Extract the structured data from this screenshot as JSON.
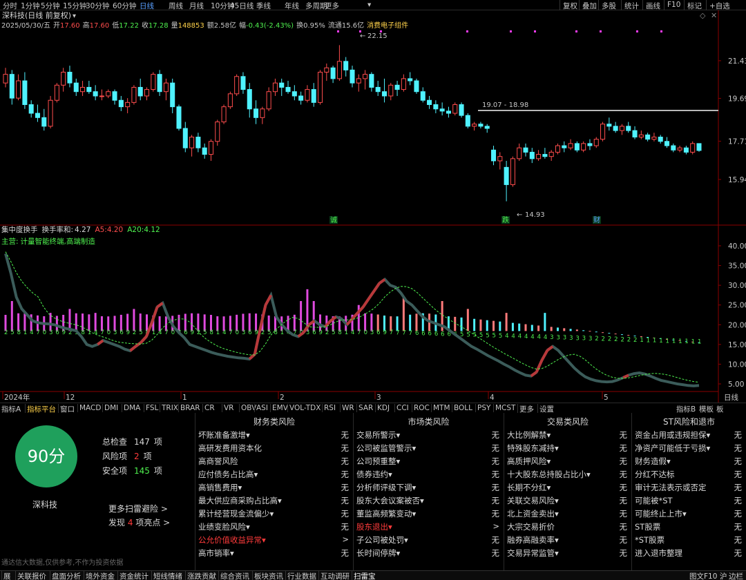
{
  "topbar": {
    "periods": [
      "分时",
      "1分钟",
      "5分钟",
      "15分钟",
      "30分钟",
      "60分钟",
      "日线",
      "周线",
      "月线",
      "10分钟",
      "45日线",
      "季线",
      "年线",
      "多周期",
      "更多"
    ],
    "active": "日线",
    "right": [
      "复权",
      "叠加",
      "多股",
      "统计",
      "画线",
      "F10",
      "标记",
      "+自选"
    ]
  },
  "header": {
    "title": "深科技(日线 前复权)",
    "date": "2025/05/30/五",
    "open_label": "开",
    "open": "17.60",
    "high_label": "高",
    "high": "17.60",
    "low_label": "低",
    "low": "17.22",
    "close_label": "收",
    "close": "17.28",
    "vol_label": "量",
    "vol": "148853",
    "amt_label": "额",
    "amt": "2.58亿",
    "chg_label": "幅",
    "chg": "-0.43(-2.43%)",
    "turn_label": "换",
    "turn": "0.95%",
    "float_label": "流通",
    "float": "15.6亿",
    "sector": "消费电子组件"
  },
  "colors": {
    "up": "#ff4d4d",
    "down": "#4ff2ff",
    "magenta": "#ff3cff",
    "line": "#2f5353",
    "accent": "#ffd24a"
  },
  "price_axis": [
    "21.43",
    "19.69",
    "17.71",
    "15.94"
  ],
  "annotations": {
    "high": "22.15",
    "low": "14.93",
    "range": "19.07 - 18.98",
    "marks": [
      "诚",
      "跌",
      "财"
    ]
  },
  "indicator": {
    "name": "集中度换手",
    "sum_label": "换手率和:",
    "sum": "4.27",
    "a5_label": "A5:",
    "a5": "4.20",
    "a20_label": "A20:",
    "a20": "4.12",
    "main_label": "主营:",
    "main": "计量智能终端,高端制造",
    "axis": [
      "40.00",
      "35.00",
      "30.00",
      "25.00",
      "20.00",
      "15.00",
      "10.00",
      "5.00"
    ]
  },
  "time_axis": [
    "2024年",
    "12",
    "1",
    "2",
    "3",
    "4",
    "5"
  ],
  "time_axis_right": "日线",
  "bottombar": {
    "tabs": [
      "指标A",
      "指标平台",
      "窗口",
      "MACD",
      "DMI",
      "DMA",
      "FSL",
      "TRIX",
      "BRAR",
      "CR",
      "VR",
      "OBV",
      "ASI",
      "EMV",
      "VOL-TDX",
      "RSI",
      "WR",
      "SAR",
      "KDJ",
      "CCI",
      "ROC",
      "MTM",
      "BOLL",
      "PSY",
      "MCST",
      "更多",
      "设置"
    ],
    "right": [
      "指标B",
      "模板",
      "板"
    ]
  },
  "chart_data": {
    "type": "candlestick",
    "ylim": [
      14.5,
      22.8
    ],
    "candles": [
      [
        20.4,
        21.1,
        20.2,
        20.8
      ],
      [
        20.8,
        21.0,
        19.4,
        19.7
      ],
      [
        19.7,
        20.8,
        19.6,
        20.5
      ],
      [
        20.5,
        20.9,
        19.2,
        19.4
      ],
      [
        19.4,
        19.6,
        18.8,
        19.0
      ],
      [
        19.0,
        19.4,
        18.6,
        18.8
      ],
      [
        18.8,
        19.2,
        18.2,
        18.4
      ],
      [
        18.4,
        19.8,
        18.3,
        19.6
      ],
      [
        19.6,
        20.4,
        19.5,
        20.3
      ],
      [
        20.3,
        21.1,
        20.0,
        20.9
      ],
      [
        20.9,
        21.2,
        20.2,
        20.4
      ],
      [
        20.4,
        20.6,
        19.8,
        20.0
      ],
      [
        20.0,
        20.5,
        19.8,
        20.2
      ],
      [
        20.2,
        20.5,
        19.9,
        20.0
      ],
      [
        20.0,
        20.3,
        19.6,
        19.8
      ],
      [
        19.8,
        20.1,
        19.6,
        19.8
      ],
      [
        19.8,
        20.1,
        19.7,
        20.0
      ],
      [
        20.0,
        20.1,
        19.4,
        19.6
      ],
      [
        19.6,
        19.8,
        19.1,
        19.3
      ],
      [
        19.3,
        19.7,
        19.0,
        19.5
      ],
      [
        19.5,
        20.3,
        19.4,
        20.2
      ],
      [
        20.2,
        20.6,
        19.6,
        19.8
      ],
      [
        19.8,
        20.2,
        19.6,
        20.1
      ],
      [
        20.1,
        20.9,
        20.0,
        20.8
      ],
      [
        20.8,
        21.0,
        19.8,
        20.0
      ],
      [
        20.0,
        20.6,
        19.6,
        20.4
      ],
      [
        20.4,
        20.6,
        19.0,
        19.3
      ],
      [
        19.3,
        19.4,
        18.2,
        18.3
      ],
      [
        18.3,
        18.6,
        17.2,
        17.4
      ],
      [
        17.4,
        18.0,
        17.0,
        17.9
      ],
      [
        17.9,
        18.1,
        17.2,
        17.4
      ],
      [
        17.4,
        17.6,
        16.9,
        17.1
      ],
      [
        17.1,
        17.8,
        16.8,
        17.7
      ],
      [
        17.7,
        18.7,
        17.5,
        18.6
      ],
      [
        18.6,
        19.4,
        18.5,
        19.3
      ],
      [
        19.3,
        20.0,
        19.2,
        19.9
      ],
      [
        19.9,
        20.8,
        19.8,
        20.7
      ],
      [
        20.7,
        20.9,
        19.9,
        20.1
      ],
      [
        20.1,
        20.4,
        18.8,
        19.2
      ],
      [
        19.2,
        19.6,
        18.5,
        18.8
      ],
      [
        18.8,
        19.3,
        18.5,
        19.2
      ],
      [
        19.2,
        20.2,
        19.1,
        20.0
      ],
      [
        20.0,
        20.6,
        19.8,
        20.4
      ],
      [
        20.4,
        20.6,
        19.8,
        20.2
      ],
      [
        20.2,
        20.5,
        19.9,
        20.0
      ],
      [
        20.0,
        20.3,
        19.6,
        19.8
      ],
      [
        19.8,
        20.0,
        19.4,
        19.6
      ],
      [
        19.6,
        20.3,
        19.5,
        20.1
      ],
      [
        20.1,
        20.4,
        19.3,
        19.5
      ],
      [
        19.5,
        21.0,
        19.4,
        20.9
      ],
      [
        20.9,
        21.3,
        20.5,
        21.1
      ],
      [
        21.1,
        21.2,
        20.4,
        20.6
      ],
      [
        20.6,
        22.15,
        20.5,
        21.4
      ],
      [
        21.4,
        21.6,
        20.7,
        21.0
      ],
      [
        21.0,
        21.2,
        20.2,
        20.4
      ],
      [
        20.4,
        20.8,
        20.0,
        20.6
      ],
      [
        20.6,
        21.0,
        20.1,
        20.8
      ],
      [
        20.8,
        20.9,
        20.0,
        20.2
      ],
      [
        20.2,
        20.5,
        19.8,
        20.0
      ],
      [
        20.0,
        20.6,
        19.5,
        19.8
      ],
      [
        19.8,
        20.4,
        19.6,
        20.3
      ],
      [
        20.3,
        20.5,
        19.8,
        20.1
      ],
      [
        20.1,
        20.8,
        20.0,
        20.6
      ],
      [
        20.6,
        20.9,
        20.3,
        20.5
      ],
      [
        20.5,
        20.6,
        19.9,
        20.0
      ],
      [
        20.0,
        20.2,
        19.5,
        19.6
      ],
      [
        19.6,
        19.8,
        19.2,
        19.4
      ],
      [
        19.4,
        19.6,
        19.0,
        19.2
      ],
      [
        19.2,
        19.5,
        18.9,
        19.1
      ],
      [
        19.1,
        19.3,
        18.8,
        19.0
      ],
      [
        19.0,
        19.5,
        18.9,
        19.4
      ],
      [
        19.4,
        19.5,
        18.8,
        18.9
      ],
      [
        18.9,
        19.0,
        18.3,
        18.4
      ],
      [
        18.4,
        18.6,
        18.2,
        18.5
      ],
      [
        18.5,
        18.6,
        18.3,
        18.4
      ],
      [
        18.4,
        18.5,
        18.1,
        18.3
      ],
      [
        17.3,
        17.5,
        16.6,
        16.8
      ],
      [
        16.8,
        17.2,
        16.4,
        17.0
      ],
      [
        16.5,
        16.8,
        14.93,
        15.7
      ],
      [
        15.7,
        17.0,
        15.6,
        16.9
      ],
      [
        16.9,
        17.6,
        16.8,
        17.4
      ],
      [
        17.4,
        17.6,
        17.0,
        17.2
      ],
      [
        17.2,
        17.4,
        16.7,
        16.9
      ],
      [
        16.9,
        17.3,
        16.8,
        17.1
      ],
      [
        17.1,
        17.4,
        16.9,
        17.0
      ],
      [
        17.0,
        17.3,
        16.8,
        17.2
      ],
      [
        17.2,
        17.6,
        17.1,
        17.5
      ],
      [
        17.5,
        17.7,
        17.2,
        17.4
      ],
      [
        17.4,
        17.8,
        17.3,
        17.6
      ],
      [
        17.6,
        17.7,
        17.2,
        17.3
      ],
      [
        17.3,
        17.7,
        17.2,
        17.6
      ],
      [
        17.6,
        17.8,
        17.3,
        17.5
      ],
      [
        17.5,
        17.9,
        17.4,
        17.8
      ],
      [
        17.8,
        18.6,
        17.7,
        18.5
      ],
      [
        18.5,
        18.8,
        18.2,
        18.4
      ],
      [
        18.4,
        18.6,
        18.1,
        18.2
      ],
      [
        18.2,
        18.5,
        18.0,
        18.4
      ],
      [
        18.4,
        18.6,
        18.1,
        18.2
      ],
      [
        18.2,
        18.4,
        17.8,
        17.9
      ],
      [
        17.9,
        18.2,
        17.8,
        18.0
      ],
      [
        18.0,
        18.1,
        17.7,
        17.8
      ],
      [
        17.8,
        18.1,
        17.7,
        17.9
      ],
      [
        17.9,
        18.0,
        17.6,
        17.7
      ],
      [
        17.7,
        17.9,
        17.4,
        17.5
      ],
      [
        17.5,
        17.6,
        17.2,
        17.3
      ],
      [
        17.3,
        17.5,
        17.2,
        17.4
      ],
      [
        17.4,
        17.5,
        17.1,
        17.2
      ],
      [
        17.2,
        17.7,
        17.1,
        17.6
      ],
      [
        17.6,
        17.6,
        17.22,
        17.28
      ]
    ]
  },
  "panel": {
    "score": "90分",
    "name": "深科技",
    "stats": [
      {
        "label": "总检查",
        "value": "147",
        "unit": "项"
      },
      {
        "label": "风险项",
        "value": "2",
        "unit": "项"
      },
      {
        "label": "安全项",
        "value": "145",
        "unit": "项"
      }
    ],
    "more": "更多扫雷避险 >",
    "find_prefix": "发现",
    "find_value": "4",
    "find_suffix": "项亮点 >",
    "disclaimer": "通达信大数据,仅供参考,不作为投资依据",
    "columns": [
      {
        "title": "财务类风险",
        "items": [
          {
            "t": "坏账准备激增▾",
            "v": "无"
          },
          {
            "t": "高研发费用资本化",
            "v": "无"
          },
          {
            "t": "高商誉风险",
            "v": "无"
          },
          {
            "t": "应付债务占比高▾",
            "v": "无"
          },
          {
            "t": "高销售费用▾",
            "v": "无"
          },
          {
            "t": "最大供应商采购占比高▾",
            "v": "无"
          },
          {
            "t": "累计经营现金流偏少▾",
            "v": "无"
          },
          {
            "t": "业绩变脸风险▾",
            "v": "无"
          },
          {
            "t": "公允价值收益异常▾",
            "v": ">",
            "red": true
          },
          {
            "t": "高市销率▾",
            "v": "无"
          }
        ]
      },
      {
        "title": "市场类风险",
        "items": [
          {
            "t": "交易所警示▾",
            "v": "无"
          },
          {
            "t": "公司被监管警示▾",
            "v": "无"
          },
          {
            "t": "公司预重整▾",
            "v": "无"
          },
          {
            "t": "债券违约▾",
            "v": "无"
          },
          {
            "t": "分析师评级下调▾",
            "v": "无"
          },
          {
            "t": "股东大会议案被否▾",
            "v": "无"
          },
          {
            "t": "董监高频繁变动▾",
            "v": "无"
          },
          {
            "t": "股东退出▾",
            "v": ">",
            "red": true
          },
          {
            "t": "子公司被处罚▾",
            "v": "无"
          },
          {
            "t": "长时间停牌▾",
            "v": "无"
          }
        ]
      },
      {
        "title": "交易类风险",
        "items": [
          {
            "t": "大比例解禁▾",
            "v": "无"
          },
          {
            "t": "特殊股东减持▾",
            "v": "无"
          },
          {
            "t": "高质押风险▾",
            "v": "无"
          },
          {
            "t": "十大股东总持股占比小▾",
            "v": "无"
          },
          {
            "t": "长期不分红▾",
            "v": "无"
          },
          {
            "t": "关联交易风险▾",
            "v": "无"
          },
          {
            "t": "北上资金卖出▾",
            "v": "无"
          },
          {
            "t": "大宗交易折价",
            "v": "无"
          },
          {
            "t": "融券高融卖率▾",
            "v": "无"
          },
          {
            "t": "交易异常监管▾",
            "v": "无"
          }
        ]
      },
      {
        "title": "ST风险和退市",
        "items": [
          {
            "t": "资金占用或违规担保▾",
            "v": "无"
          },
          {
            "t": "净资产可能低于亏损▾",
            "v": "无"
          },
          {
            "t": "财务造假▾",
            "v": "无"
          },
          {
            "t": "分红不达标",
            "v": "无"
          },
          {
            "t": "审计无法表示或否定",
            "v": "无"
          },
          {
            "t": "可能被*ST",
            "v": "无"
          },
          {
            "t": "可能终止上市▾",
            "v": "无"
          },
          {
            "t": "ST股票",
            "v": "无"
          },
          {
            "t": "*ST股票",
            "v": "无"
          },
          {
            "t": "进入退市整理",
            "v": "无"
          }
        ]
      }
    ]
  },
  "taskbar": [
    "展",
    "关联报价",
    "盘面分析",
    "境外资金",
    "资金统计",
    "短线情绪",
    "涨跌贡献",
    "综合资讯",
    "板块资讯",
    "行业数据",
    "互动调研",
    "扫雷宝"
  ],
  "taskbar_right": [
    "图文F10",
    "沪",
    "边栏"
  ]
}
